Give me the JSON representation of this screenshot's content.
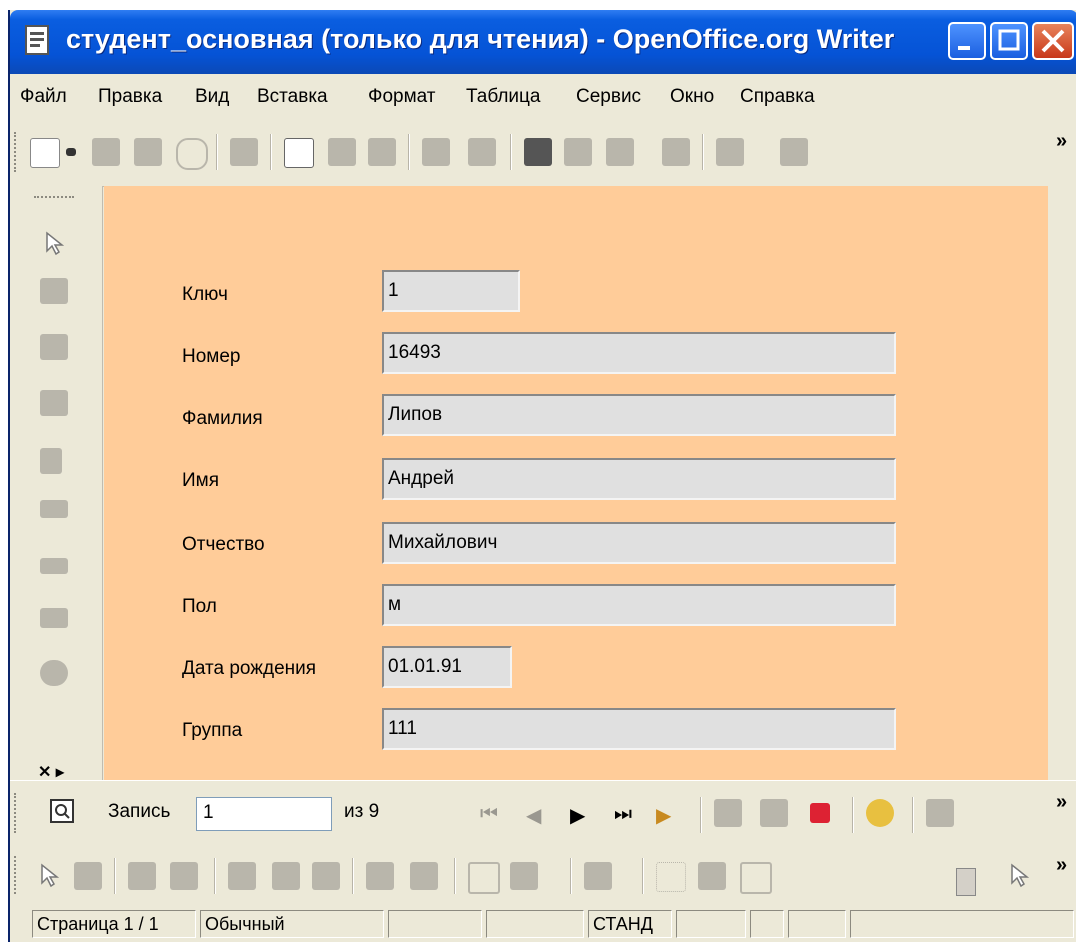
{
  "window": {
    "title": "студент_основная (только для чтения) - OpenOffice.org Writer"
  },
  "menu": [
    {
      "label": "Файл"
    },
    {
      "label": "Правка"
    },
    {
      "label": "Вид"
    },
    {
      "label": "Вставка"
    },
    {
      "label": "Формат"
    },
    {
      "label": "Таблица"
    },
    {
      "label": "Сервис"
    },
    {
      "label": "Окно"
    },
    {
      "label": "Справка"
    }
  ],
  "toolbar": {
    "more_glyph": "»"
  },
  "form": {
    "fields": [
      {
        "label": "Ключ",
        "value": "1"
      },
      {
        "label": "Номер",
        "value": "16493"
      },
      {
        "label": "Фамилия",
        "value": "Липов"
      },
      {
        "label": "Имя",
        "value": "Андрей"
      },
      {
        "label": "Отчество",
        "value": "Михайлович"
      },
      {
        "label": "Пол",
        "value": "м"
      },
      {
        "label": "Дата рождения",
        "value": "01.01.91"
      },
      {
        "label": "Группа",
        "value": "111"
      }
    ]
  },
  "navigation": {
    "record_label": "Запись",
    "record_value": "1",
    "of_label": "из 9"
  },
  "status": {
    "page": "Страница  1 / 1",
    "style": "Обычный",
    "mode": "СТАНД"
  },
  "colors": {
    "document_background": "#ffcc99",
    "titlebar": "#0553d6"
  }
}
